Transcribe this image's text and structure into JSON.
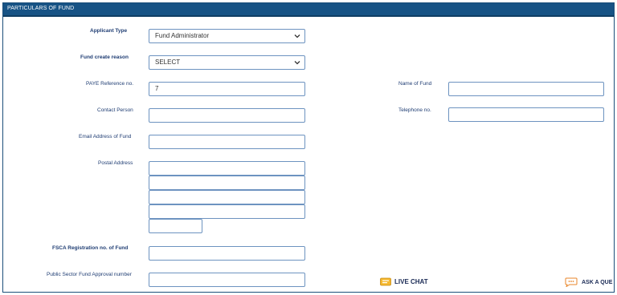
{
  "header": {
    "title": "PARTICULARS OF FUND"
  },
  "form": {
    "applicant_type": {
      "label": "Applicant Type",
      "value": "Fund Administrator"
    },
    "create_reason": {
      "label": "Fund create reason",
      "value": "SELECT"
    },
    "paye_ref": {
      "label": "PAYE Reference no.",
      "value": "7"
    },
    "name_of_fund": {
      "label": "Name of Fund",
      "value": ""
    },
    "contact_person": {
      "label": "Contact Person",
      "value": ""
    },
    "telephone": {
      "label": "Telephone no.",
      "value": ""
    },
    "email": {
      "label": "Email Address of Fund",
      "value": ""
    },
    "postal_address": {
      "label": "Postal Address"
    },
    "fsca_reg": {
      "label": "FSCA Registration no. of Fund",
      "value": ""
    },
    "public_sector": {
      "label": "Public Sector Fund Approval number",
      "value": ""
    }
  },
  "footer": {
    "live_chat": "LIVE CHAT",
    "ask_question": "ASK A QUE"
  },
  "colors": {
    "header_bg": "#175385",
    "field_border": "#6d93c0",
    "label_text": "#1f3d73"
  }
}
